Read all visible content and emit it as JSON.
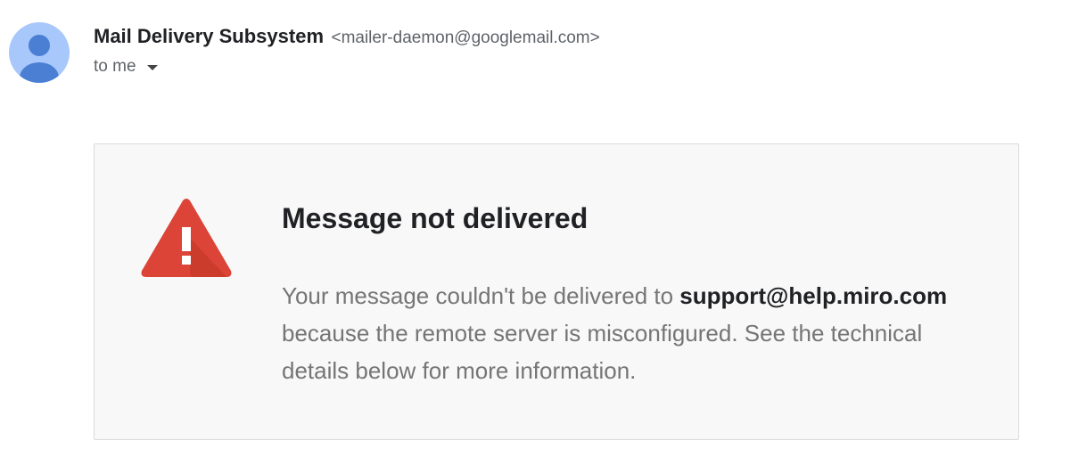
{
  "sender": {
    "name": "Mail Delivery Subsystem",
    "email": "<mailer-daemon@googlemail.com>"
  },
  "recipient": {
    "label": "to me"
  },
  "bounce": {
    "title": "Message not delivered",
    "body_before": "Your message couldn't be delivered to ",
    "address": "support@help.miro.com",
    "body_after": " because the remote server is misconfigured. See the technical details below for more information."
  },
  "icons": {
    "avatar": "person-avatar-icon",
    "caret": "chevron-down-icon",
    "warning": "warning-triangle-icon"
  },
  "colors": {
    "avatar_bg": "#a8c7fa",
    "avatar_fg": "#4a7fd4",
    "warning": "#db4437",
    "warning_shadow": "#c53929",
    "card_bg": "#f8f8f8"
  }
}
